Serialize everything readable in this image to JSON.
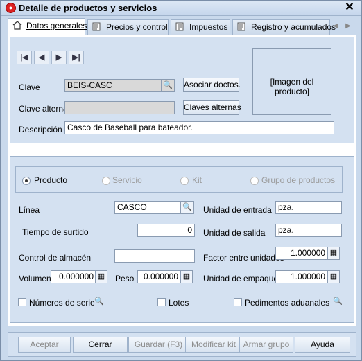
{
  "window": {
    "title": "Detalle de productos y servicios",
    "close_glyph": "✕"
  },
  "tabs": [
    {
      "label": "Datos generales",
      "icon": "home-icon"
    },
    {
      "label": "Precios y control",
      "icon": "prices-icon"
    },
    {
      "label": "Impuestos",
      "icon": "taxes-icon"
    },
    {
      "label": "Registro y acumulados",
      "icon": "records-icon"
    }
  ],
  "nav": {
    "first": "|◀",
    "prev": "◀",
    "next": "▶",
    "last": "▶|"
  },
  "general": {
    "clave_label": "Clave",
    "clave_value": "BEIS-CASC",
    "clave_alterna_label": "Clave alterna",
    "clave_alterna_value": "",
    "descripcion_label": "Descripción",
    "descripcion_value": "Casco de Baseball para bateador.",
    "asociar_label": "Asociar doctos.",
    "claves_alternas_label": "Claves alternas",
    "imagen_label": "[Imagen del producto]"
  },
  "type": {
    "options": [
      "Producto",
      "Servicio",
      "Kit",
      "Grupo de productos"
    ],
    "selected": "Producto"
  },
  "details": {
    "linea_label": "Línea",
    "linea_value": "CASCO",
    "tiempo_label": "Tiempo de surtido",
    "tiempo_value": "0",
    "control_label": "Control de almacén",
    "control_value": "",
    "volumen_label": "Volumen",
    "volumen_value": "0.000000",
    "peso_label": "Peso",
    "peso_value": "0.000000",
    "unidad_entrada_label": "Unidad de entrada",
    "unidad_entrada_value": "pza.",
    "unidad_salida_label": "Unidad de salida",
    "unidad_salida_value": "pza.",
    "factor_label": "Factor entre unidades",
    "factor_value": "1.000000",
    "unidad_empaque_label": "Unidad de empaque",
    "unidad_empaque_value": "1.000000",
    "numeros_serie_label": "Números de serie",
    "lotes_label": "Lotes",
    "pedimentos_label": "Pedimentos aduanales"
  },
  "footer": {
    "aceptar": "Aceptar",
    "cerrar": "Cerrar",
    "guardar": "Guardar (F3)",
    "modificar_kit": "Modificar kit",
    "armar_grupo": "Armar grupo",
    "ayuda": "Ayuda"
  },
  "colors": {
    "frame": "#c9d9ec",
    "panel": "#d4e1f1",
    "accent_icon": "#dd2222"
  }
}
